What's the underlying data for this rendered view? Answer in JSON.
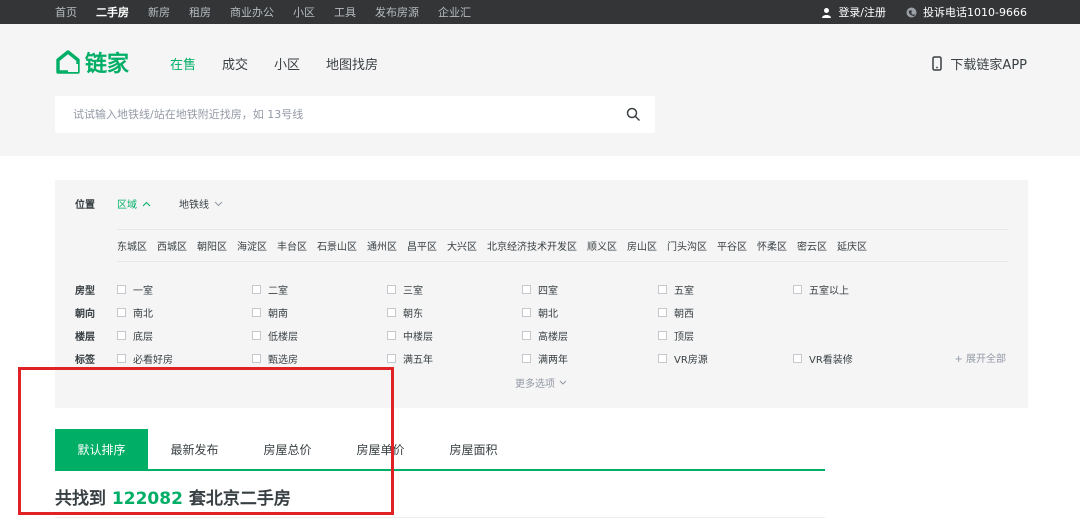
{
  "topbar": {
    "nav": [
      "首页",
      "二手房",
      "新房",
      "租房",
      "商业办公",
      "小区",
      "工具",
      "发布房源",
      "企业汇"
    ],
    "active_nav": "二手房",
    "login": "登录/注册",
    "hotline": "投诉电话1010-9666"
  },
  "header": {
    "logo_text": "链家",
    "nav": [
      "在售",
      "成交",
      "小区",
      "地图找房"
    ],
    "active_nav": "在售",
    "app_download": "下载链家APP",
    "search_placeholder": "试试输入地铁线/站在地铁附近找房，如 13号线"
  },
  "filter": {
    "position_label": "位置",
    "tabs": [
      "区域",
      "地铁线"
    ],
    "districts": [
      "东城区",
      "西城区",
      "朝阳区",
      "海淀区",
      "丰台区",
      "石景山区",
      "通州区",
      "昌平区",
      "大兴区",
      "北京经济技术开发区",
      "顺义区",
      "房山区",
      "门头沟区",
      "平谷区",
      "怀柔区",
      "密云区",
      "延庆区"
    ],
    "rows": [
      {
        "label": "房型",
        "options": [
          "一室",
          "二室",
          "三室",
          "四室",
          "五室",
          "五室以上"
        ]
      },
      {
        "label": "朝向",
        "options": [
          "南北",
          "朝南",
          "朝东",
          "朝北",
          "朝西"
        ]
      },
      {
        "label": "楼层",
        "options": [
          "底层",
          "低楼层",
          "中楼层",
          "高楼层",
          "顶层"
        ]
      },
      {
        "label": "标签",
        "options": [
          "必看好房",
          "甄选房",
          "满五年",
          "满两年",
          "VR房源",
          "VR看装修"
        ]
      }
    ],
    "expand_all": "+ 展开全部",
    "more_options": "更多选项"
  },
  "sort": {
    "tabs": [
      "默认排序",
      "最新发布",
      "房屋总价",
      "房屋单价",
      "房屋面积"
    ],
    "active": "默认排序"
  },
  "result": {
    "prefix": "共找到",
    "count": "122082",
    "suffix": "套北京二手房"
  },
  "colors": {
    "brand": "#00ae66",
    "topbar_bg": "#333537",
    "annotation": "#e02227"
  }
}
